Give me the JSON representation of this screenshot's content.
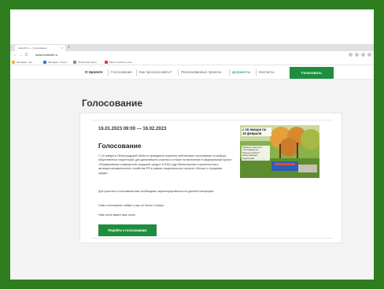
{
  "browser": {
    "tab_title": "ivoteinff.ru — Голосование",
    "tab_close": "×",
    "new_tab": "+",
    "back": "←",
    "forward": "→",
    "reload": "C",
    "url": "www.ivoteinff.ru",
    "bookmarks": [
      {
        "label": "Закладки • Ле...",
        "color": "#f2b233"
      },
      {
        "label": "Закладки • Почта",
        "color": "#3b6fd6"
      },
      {
        "label": "Публичная карта",
        "color": "#888888"
      },
      {
        "label": "Магнит каталог улиц",
        "color": "#d23c3c"
      }
    ]
  },
  "site_nav": {
    "items": [
      {
        "label": "О проекте",
        "active": true
      },
      {
        "label": "Голосование",
        "active": false
      },
      {
        "label": "Как проголосовать?",
        "active": false
      },
      {
        "label": "Реализованные проекты",
        "active": false
      },
      {
        "label": "Документы",
        "active": false
      },
      {
        "label": "Контакты",
        "active": false
      }
    ],
    "vote_button": "Голосовать"
  },
  "page": {
    "title": "Голосование"
  },
  "card": {
    "dates": "16.01.2023 09:00 — 16.02.2023",
    "heading": "Голосование",
    "paragraphs": [
      "С 16 января в Ленинградской области проводится открытое рейтинговое голосование по выбору общественных территорий, для дальнейшего участия в отборе на включение в федеральный проект «Формирование комфортной городской среды» в 2024 году Министерства строительства и жилищно-коммунального хозяйства РФ в рамках национального проекта «Жилье и городская среда».",
      "Для участия в голосовании вам необходимо зарегистрироваться на данной платформе.",
      "Само голосование займет у вас не более 2 минут.",
      "Нам очень важен ваш голос."
    ],
    "button": "Перейти к голосованию",
    "promo": {
      "headline": "с 16 января по 16 февраля",
      "subtext": "Примите участие в голосовании за благоустройство общественных территорий"
    }
  },
  "colors": {
    "frame": "#2e7d1e",
    "accent": "#1e8e3e",
    "page_bg": "#f3f3f3"
  }
}
